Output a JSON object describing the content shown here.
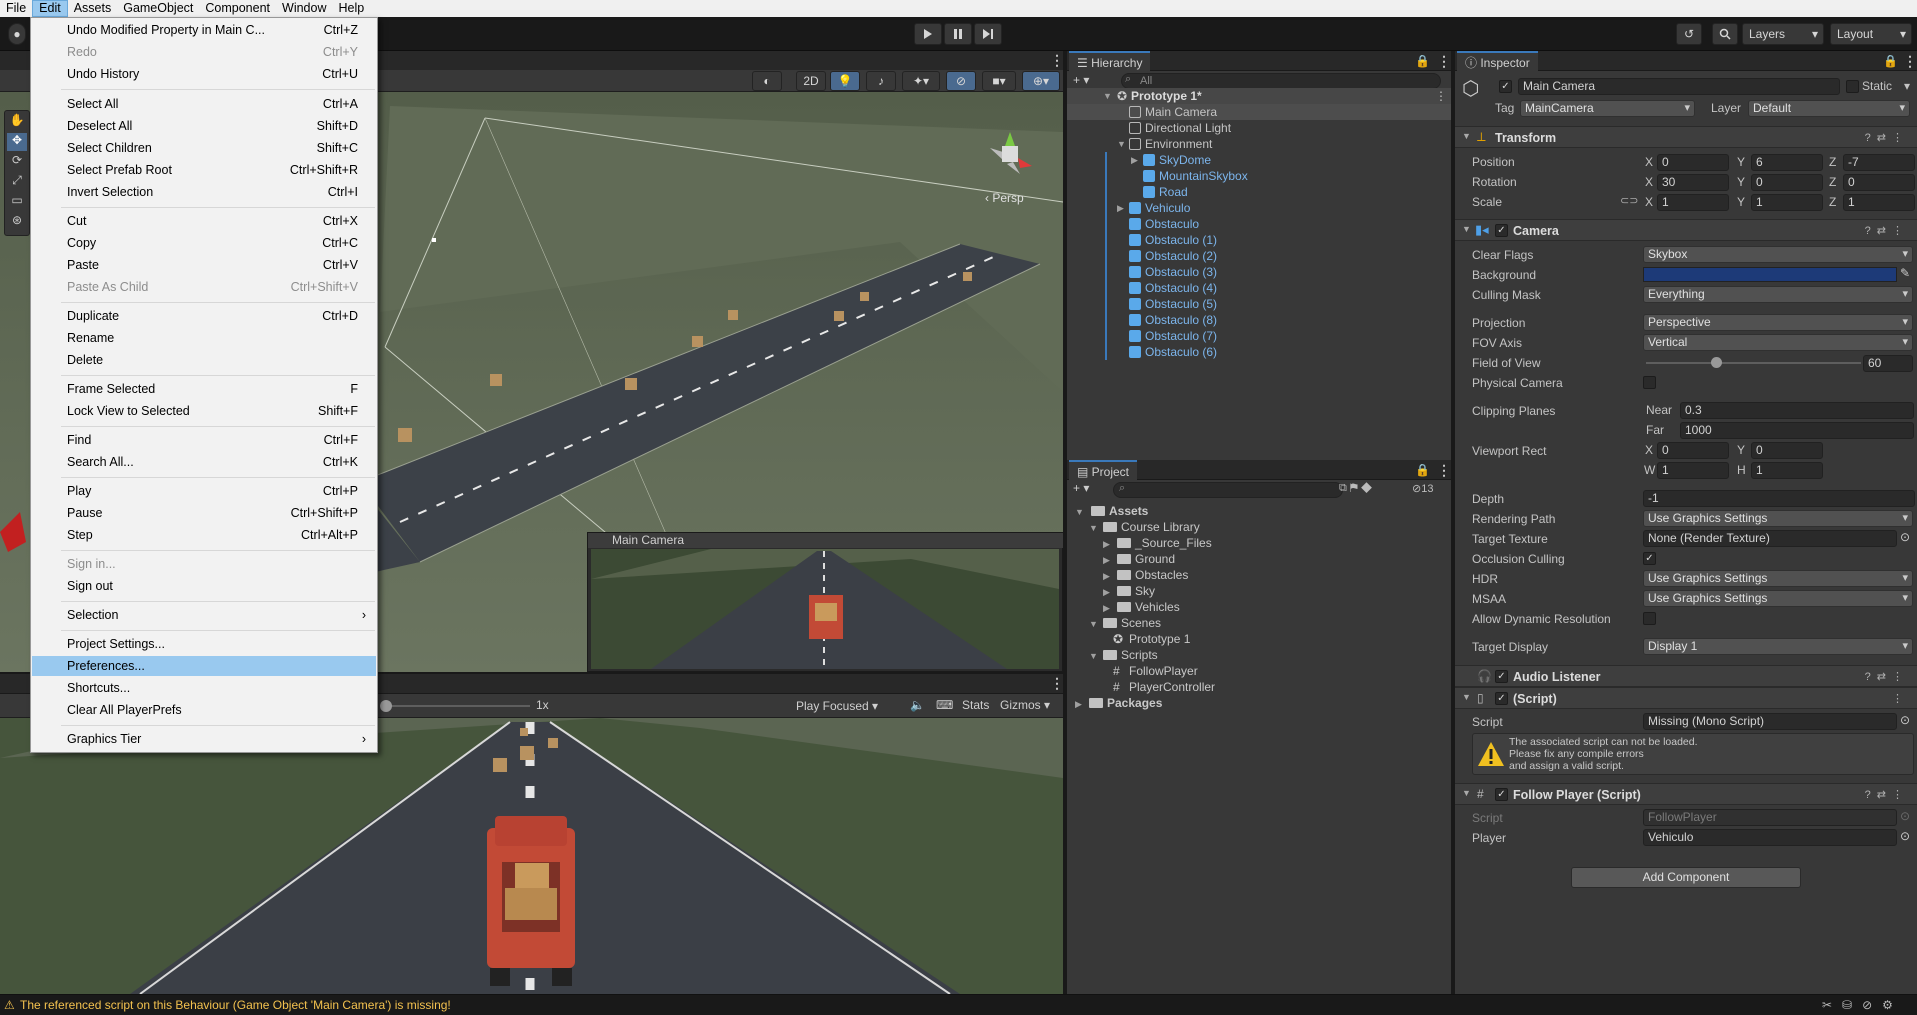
{
  "menubar": [
    "File",
    "Edit",
    "Assets",
    "GameObject",
    "Component",
    "Window",
    "Help"
  ],
  "toolbar": {
    "layers": "Layers",
    "layout": "Layout"
  },
  "scene": {
    "btn_2d": "2D",
    "persp": "Persp"
  },
  "edit_menu": [
    {
      "label": "Undo Modified Property in Main C...",
      "shortcut": "Ctrl+Z",
      "disabled": false
    },
    {
      "label": "Redo",
      "shortcut": "Ctrl+Y",
      "disabled": true
    },
    {
      "label": "Undo History",
      "shortcut": "Ctrl+U",
      "disabled": false
    },
    {
      "label": "Select All",
      "shortcut": "Ctrl+A",
      "disabled": false
    },
    {
      "label": "Deselect All",
      "shortcut": "Shift+D",
      "disabled": false
    },
    {
      "label": "Select Children",
      "shortcut": "Shift+C",
      "disabled": false
    },
    {
      "label": "Select Prefab Root",
      "shortcut": "Ctrl+Shift+R",
      "disabled": false
    },
    {
      "label": "Invert Selection",
      "shortcut": "Ctrl+I",
      "disabled": false
    },
    {
      "label": "Cut",
      "shortcut": "Ctrl+X",
      "disabled": false
    },
    {
      "label": "Copy",
      "shortcut": "Ctrl+C",
      "disabled": false
    },
    {
      "label": "Paste",
      "shortcut": "Ctrl+V",
      "disabled": false
    },
    {
      "label": "Paste As Child",
      "shortcut": "Ctrl+Shift+V",
      "disabled": true
    },
    {
      "label": "Duplicate",
      "shortcut": "Ctrl+D",
      "disabled": false
    },
    {
      "label": "Rename",
      "shortcut": "",
      "disabled": false
    },
    {
      "label": "Delete",
      "shortcut": "",
      "disabled": false
    },
    {
      "label": "Frame Selected",
      "shortcut": "F",
      "disabled": false
    },
    {
      "label": "Lock View to Selected",
      "shortcut": "Shift+F",
      "disabled": false
    },
    {
      "label": "Find",
      "shortcut": "Ctrl+F",
      "disabled": false
    },
    {
      "label": "Search All...",
      "shortcut": "Ctrl+K",
      "disabled": false
    },
    {
      "label": "Play",
      "shortcut": "Ctrl+P",
      "disabled": false
    },
    {
      "label": "Pause",
      "shortcut": "Ctrl+Shift+P",
      "disabled": false
    },
    {
      "label": "Step",
      "shortcut": "Ctrl+Alt+P",
      "disabled": false
    },
    {
      "label": "Sign in...",
      "shortcut": "",
      "disabled": true
    },
    {
      "label": "Sign out",
      "shortcut": "",
      "disabled": false
    },
    {
      "label": "Selection",
      "shortcut": "",
      "disabled": false
    },
    {
      "label": "Project Settings...",
      "shortcut": "",
      "disabled": false
    },
    {
      "label": "Preferences...",
      "shortcut": "",
      "disabled": false
    },
    {
      "label": "Shortcuts...",
      "shortcut": "",
      "disabled": false
    },
    {
      "label": "Clear All PlayerPrefs",
      "shortcut": "",
      "disabled": false
    },
    {
      "label": "Graphics Tier",
      "shortcut": "",
      "disabled": false
    }
  ],
  "camera_preview": {
    "title": "Main Camera"
  },
  "game_view": {
    "scale": "1x",
    "play_mode": "Play Focused",
    "stats": "Stats",
    "gizmos": "Gizmos"
  },
  "hierarchy": {
    "tab": "Hierarchy",
    "search_placeholder": "All",
    "scene": "Prototype 1*",
    "items": [
      "Main Camera",
      "Directional Light",
      "Environment",
      "SkyDome",
      "MountainSkybox",
      "Road",
      "Vehiculo",
      "Obstaculo",
      "Obstaculo (1)",
      "Obstaculo (2)",
      "Obstaculo (3)",
      "Obstaculo (4)",
      "Obstaculo (5)",
      "Obstaculo (8)",
      "Obstaculo (7)",
      "Obstaculo (6)"
    ]
  },
  "project": {
    "tab": "Project",
    "count": "13",
    "items": [
      "Assets",
      "Course Library",
      "_Source_Files",
      "Ground",
      "Obstacles",
      "Sky",
      "Vehicles",
      "Scenes",
      "Prototype 1",
      "Scripts",
      "FollowPlayer",
      "PlayerController",
      "Packages"
    ]
  },
  "inspector": {
    "tab": "Inspector",
    "object_name": "Main Camera",
    "static": "Static",
    "tag_label": "Tag",
    "tag": "MainCamera",
    "layer_label": "Layer",
    "layer": "Default",
    "transform": {
      "title": "Transform",
      "position_label": "Position",
      "rotation_label": "Rotation",
      "scale_label": "Scale",
      "position": [
        "0",
        "6",
        "-7"
      ],
      "rotation": [
        "30",
        "0",
        "0"
      ],
      "scale": [
        "1",
        "1",
        "1"
      ]
    },
    "camera": {
      "title": "Camera",
      "clear_flags_label": "Clear Flags",
      "clear_flags": "Skybox",
      "background_label": "Background",
      "background_color": "#1d3a78",
      "culling_mask_label": "Culling Mask",
      "culling_mask": "Everything",
      "projection_label": "Projection",
      "projection": "Perspective",
      "fov_axis_label": "FOV Axis",
      "fov_axis": "Vertical",
      "fov_label": "Field of View",
      "fov": "60",
      "physical_label": "Physical Camera",
      "clipping_label": "Clipping Planes",
      "near_label": "Near",
      "near": "0.3",
      "far_label": "Far",
      "far": "1000",
      "viewport_label": "Viewport Rect",
      "vx": "0",
      "vy": "0",
      "vw": "1",
      "vh": "1",
      "depth_label": "Depth",
      "depth": "-1",
      "rendering_path_label": "Rendering Path",
      "rendering_path": "Use Graphics Settings",
      "target_texture_label": "Target Texture",
      "target_texture": "None (Render Texture)",
      "occlusion_label": "Occlusion Culling",
      "hdr_label": "HDR",
      "hdr": "Use Graphics Settings",
      "msaa_label": "MSAA",
      "msaa": "Use Graphics Settings",
      "dynres_label": "Allow Dynamic Resolution",
      "target_display_label": "Target Display",
      "target_display": "Display 1"
    },
    "audio_listener": "Audio Listener",
    "missing_script": {
      "title": "(Script)",
      "script_label": "Script",
      "script": "Missing (Mono Script)",
      "warning": [
        "The associated script can not be loaded.",
        "Please fix any compile errors",
        "and assign a valid script."
      ]
    },
    "follow_player": {
      "title": "Follow Player (Script)",
      "script_label": "Script",
      "script": "FollowPlayer",
      "player_label": "Player",
      "player": "Vehiculo"
    },
    "add_component": "Add Component"
  },
  "status": "The referenced script on this Behaviour (Game Object 'Main Camera') is missing!"
}
